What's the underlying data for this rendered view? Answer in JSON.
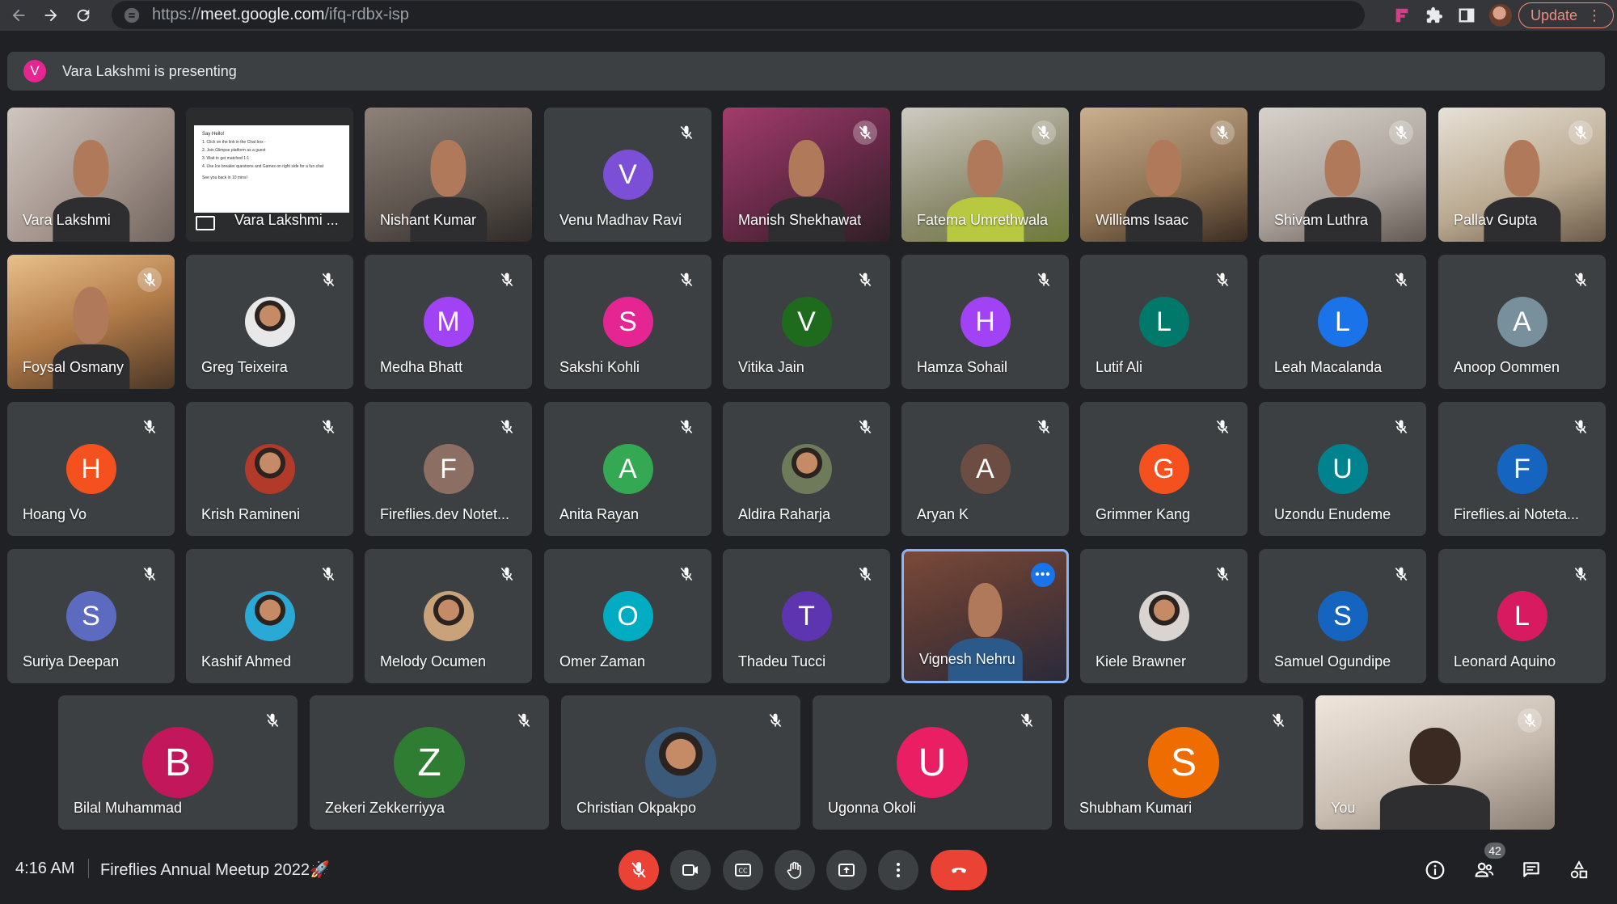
{
  "browser": {
    "url_scheme": "https://",
    "url_host": "meet.google.com",
    "url_path": "/ifq-rdbx-isp",
    "update_label": "Update"
  },
  "banner": {
    "avatar_letter": "V",
    "text": "Vara Lakshmi is presenting"
  },
  "tiles": [
    {
      "name": "Vara Lakshmi",
      "kind": "video",
      "cls": "v1",
      "muted": false
    },
    {
      "name": "Vara Lakshmi ...",
      "kind": "slide",
      "muted": false
    },
    {
      "name": "Nishant Kumar",
      "kind": "video",
      "cls": "v3",
      "muted": false
    },
    {
      "name": "Venu Madhav Ravi",
      "kind": "avatar",
      "letter": "V",
      "color": "#7b4fd6",
      "muted": true
    },
    {
      "name": "Manish Shekhawat",
      "kind": "video",
      "cls": "v5",
      "muted": true
    },
    {
      "name": "Fatema Umrethwala",
      "kind": "video",
      "cls": "v6",
      "muted": true
    },
    {
      "name": "Williams Isaac",
      "kind": "video",
      "cls": "v7",
      "muted": true
    },
    {
      "name": "Shivam Luthra",
      "kind": "video",
      "cls": "v8",
      "muted": true
    },
    {
      "name": "Pallav Gupta",
      "kind": "video",
      "cls": "v9",
      "muted": true
    },
    {
      "name": "Foysal Osmany",
      "kind": "video",
      "cls": "v10",
      "muted": true
    },
    {
      "name": "Greg Teixeira",
      "kind": "photo",
      "color": "#e8e8e8",
      "muted": true
    },
    {
      "name": "Medha Bhatt",
      "kind": "avatar",
      "letter": "M",
      "color": "#a142f4",
      "muted": true
    },
    {
      "name": "Sakshi Kohli",
      "kind": "avatar",
      "letter": "S",
      "color": "#e52592",
      "muted": true
    },
    {
      "name": "Vitika Jain",
      "kind": "avatar",
      "letter": "V",
      "color": "#1e6b1e",
      "muted": true
    },
    {
      "name": "Hamza Sohail",
      "kind": "avatar",
      "letter": "H",
      "color": "#a142f4",
      "muted": true
    },
    {
      "name": "Lutif Ali",
      "kind": "avatar",
      "letter": "L",
      "color": "#00796b",
      "muted": true
    },
    {
      "name": "Leah Macalanda",
      "kind": "avatar",
      "letter": "L",
      "color": "#1a73e8",
      "muted": true
    },
    {
      "name": "Anoop Oommen",
      "kind": "avatar",
      "letter": "A",
      "color": "#78909c",
      "muted": true
    },
    {
      "name": "Hoang Vo",
      "kind": "avatar",
      "letter": "H",
      "color": "#f4511e",
      "muted": true
    },
    {
      "name": "Krish Ramineni",
      "kind": "photo",
      "color": "#b23a2a",
      "muted": true
    },
    {
      "name": "Fireflies.dev Notet...",
      "kind": "avatar",
      "letter": "F",
      "color": "#8d6e63",
      "muted": true
    },
    {
      "name": "Anita Rayan",
      "kind": "avatar",
      "letter": "A",
      "color": "#34a853",
      "muted": true
    },
    {
      "name": "Aldira Raharja",
      "kind": "photo",
      "color": "#6d7b5a",
      "muted": true
    },
    {
      "name": "Aryan K",
      "kind": "avatar",
      "letter": "A",
      "color": "#6d4c41",
      "muted": true
    },
    {
      "name": "Grimmer Kang",
      "kind": "avatar",
      "letter": "G",
      "color": "#f4511e",
      "muted": true
    },
    {
      "name": "Uzondu Enudeme",
      "kind": "avatar",
      "letter": "U",
      "color": "#00838f",
      "muted": true
    },
    {
      "name": "Fireflies.ai Noteta...",
      "kind": "avatar",
      "letter": "F",
      "color": "#1565c0",
      "muted": true
    },
    {
      "name": "Suriya Deepan",
      "kind": "avatar",
      "letter": "S",
      "color": "#5c6bc0",
      "muted": true
    },
    {
      "name": "Kashif Ahmed",
      "kind": "photo",
      "color": "#2aa9d6",
      "muted": true
    },
    {
      "name": "Melody Ocumen",
      "kind": "photo",
      "color": "#c9a27a",
      "muted": true
    },
    {
      "name": "Omer Zaman",
      "kind": "avatar",
      "letter": "O",
      "color": "#00acc1",
      "muted": true
    },
    {
      "name": "Thadeu Tucci",
      "kind": "avatar",
      "letter": "T",
      "color": "#5e35b1",
      "muted": true
    },
    {
      "name": "Vignesh Nehru",
      "kind": "video",
      "cls": "vig",
      "muted": false,
      "active": true
    },
    {
      "name": "Kiele Brawner",
      "kind": "photo",
      "color": "#d9d4d0",
      "muted": true
    },
    {
      "name": "Samuel Ogundipe",
      "kind": "avatar",
      "letter": "S",
      "color": "#1565c0",
      "muted": true
    },
    {
      "name": "Leonard Aquino",
      "kind": "avatar",
      "letter": "L",
      "color": "#d81b60",
      "muted": true
    }
  ],
  "bottom_tiles": [
    {
      "name": "Bilal Muhammad",
      "kind": "avatar",
      "letter": "B",
      "color": "#c2185b",
      "muted": true
    },
    {
      "name": "Zekeri Zekkerriyya",
      "kind": "avatar",
      "letter": "Z",
      "color": "#2e7d32",
      "muted": true
    },
    {
      "name": "Christian Okpakpo",
      "kind": "photo",
      "color": "#3b5a7a",
      "muted": true
    },
    {
      "name": "Ugonna Okoli",
      "kind": "avatar",
      "letter": "U",
      "color": "#e91e63",
      "muted": true
    },
    {
      "name": "Shubham Kumari",
      "kind": "avatar",
      "letter": "S",
      "color": "#ef6c00",
      "muted": true
    },
    {
      "name": "You",
      "kind": "video",
      "cls": "you",
      "muted": true
    }
  ],
  "slide": {
    "heading": "Say Hello!",
    "lines": [
      "Click on the link in the Chat box -",
      "Join Glimpse platform as a guest",
      "Wait to get matched 1:1",
      "Use Ice breaker questions and Games on right side for a fun chat"
    ],
    "footer": "See you back in 10 mins!"
  },
  "bottom_bar": {
    "time": "4:16 AM",
    "meeting_title": "Fireflies Annual Meetup 2022🚀",
    "participant_count": "42"
  },
  "colors": {
    "background": "#202124",
    "tile": "#3c4043",
    "end_call": "#ea4335",
    "active_border": "#8ab4f8"
  },
  "icons": [
    "back-arrow-icon",
    "forward-arrow-icon",
    "reload-icon",
    "site-info-icon",
    "extension-icon",
    "puzzle-icon",
    "sidepanel-icon",
    "mic-off-icon",
    "camera-icon",
    "captions-icon",
    "raise-hand-icon",
    "present-icon",
    "more-options-icon",
    "end-call-icon",
    "info-icon",
    "people-icon",
    "chat-icon",
    "activities-icon"
  ]
}
